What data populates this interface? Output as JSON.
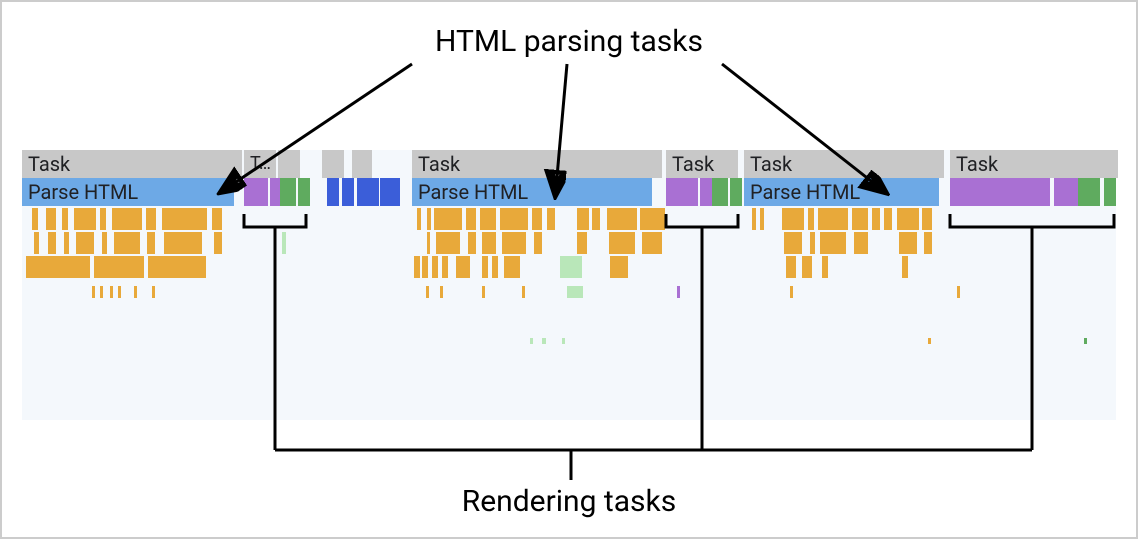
{
  "labels": {
    "top": "HTML parsing tasks",
    "bottom": "Rendering tasks"
  },
  "rows": {
    "task": "Task",
    "task_trunc": "T…",
    "parse": "Parse HTML"
  },
  "colors": {
    "task": "#c8c8c8",
    "parse": "#6da9e6",
    "purple": "#a970d3",
    "green": "#5fab5f",
    "yellow": "#e8a93a",
    "background_trace": "#f4f8fc"
  },
  "note": "Annotated DevTools performance trace showing three Parse HTML tasks and three rendering task groups."
}
